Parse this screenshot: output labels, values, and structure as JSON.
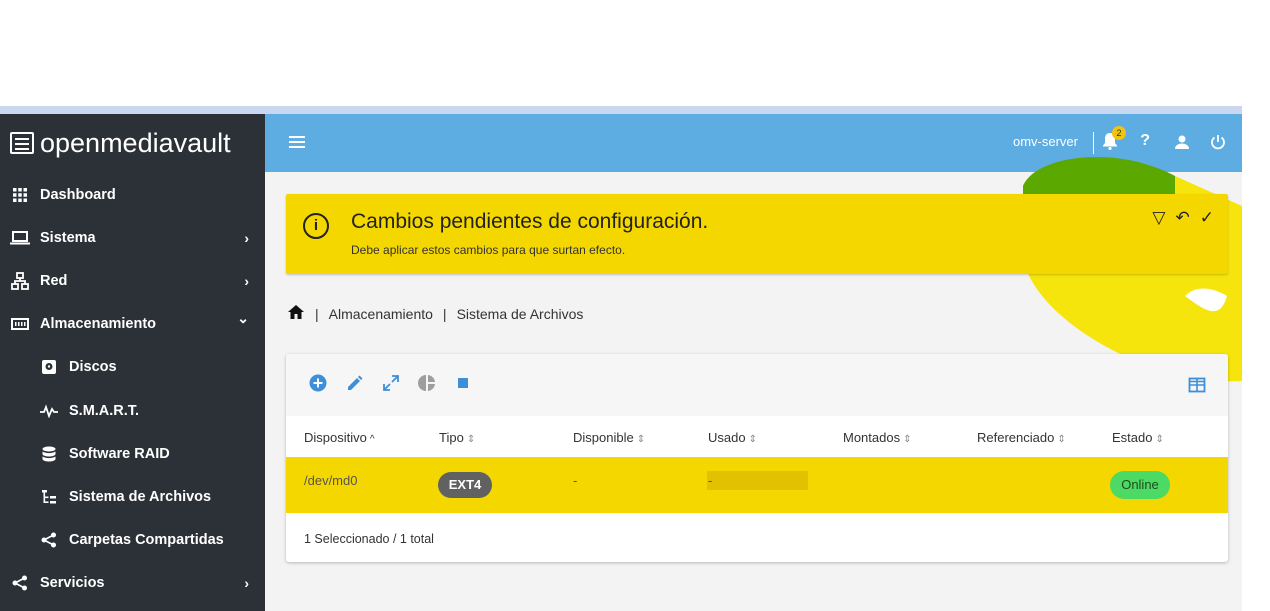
{
  "app": {
    "logo_text": "openmediavault",
    "server_name": "omv-server",
    "notification_count": "2"
  },
  "sidebar": {
    "items": [
      {
        "label": "Dashboard",
        "icon": "grid-icon",
        "chevron": ""
      },
      {
        "label": "Sistema",
        "icon": "laptop-icon",
        "chevron": "›"
      },
      {
        "label": "Red",
        "icon": "network-icon",
        "chevron": "›"
      },
      {
        "label": "Almacenamiento",
        "icon": "storage-icon",
        "chevron": "⌄"
      },
      {
        "label": "Discos",
        "icon": "disk-icon",
        "chevron": ""
      },
      {
        "label": "S.M.A.R.T.",
        "icon": "pulse-icon",
        "chevron": "›"
      },
      {
        "label": "Software RAID",
        "icon": "database-icon",
        "chevron": ""
      },
      {
        "label": "Sistema de Archivos",
        "icon": "tree-icon",
        "chevron": ""
      },
      {
        "label": "Carpetas Compartidas",
        "icon": "share-icon",
        "chevron": ""
      },
      {
        "label": "Servicios",
        "icon": "share-icon",
        "chevron": "›"
      }
    ]
  },
  "alert": {
    "title": "Cambios pendientes de configuración.",
    "subtitle": "Debe aplicar estos cambios para que surtan efecto."
  },
  "breadcrumb": {
    "items": [
      "Almacenamiento",
      "Sistema de Archivos"
    ]
  },
  "table": {
    "columns": [
      "Dispositivo",
      "Tipo",
      "Disponible",
      "Usado",
      "Montados",
      "Referenciado",
      "Estado"
    ],
    "rows": [
      {
        "device": "/dev/md0",
        "type": "EXT4",
        "available": "-",
        "used": "-",
        "mounted": "",
        "referenced": "",
        "status": "Online"
      }
    ],
    "footer": "1 Seleccionado / 1 total"
  },
  "colors": {
    "topbar": "#5dade2",
    "sidebar": "#2b3137",
    "alert": "#f5d700",
    "online": "#4cd964"
  }
}
